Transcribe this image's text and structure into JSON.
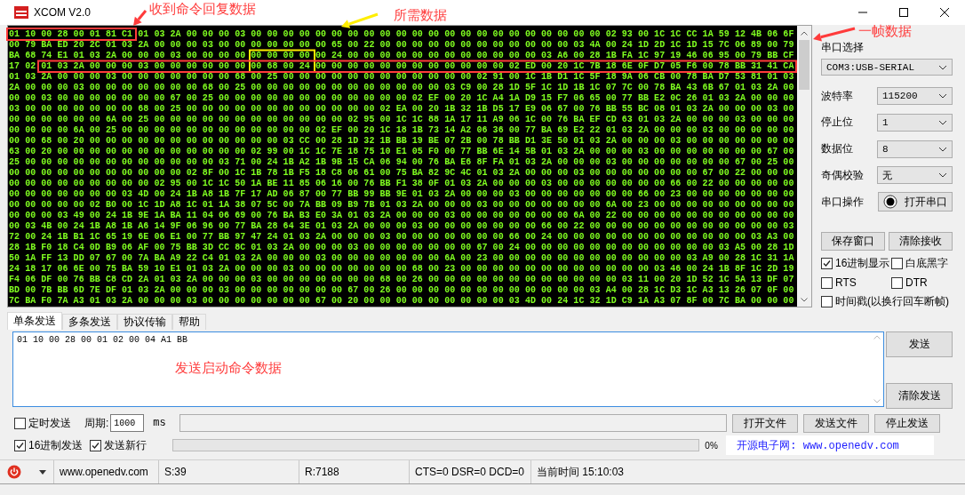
{
  "window": {
    "title": "XCOM V2.0"
  },
  "receive": {
    "rows": [
      "01 10 00 28 00 01 81 C1 01 03 2A 00 00 00 03 00 00 00 00 00 00 00 00 00 00 00 00 00 00 00 00 00 00 00 00 00 00 02 93 00 1C 1C CC 1A 59 12 4B 06 6F",
      "00 79 BA ED 20 2C 01 03 2A 00 00 00 03 00 00 00 00 00 00 00 65 00 22 00 00 00 00 00 00 00 00 00 00 00 00 03 4A 00 24 1D 2D 1C 1D 15 7C 06 89 00 79",
      "BA 68 74 E1 01 03 2A 00 00 00 03 00 00 00 00 00 00 00 00 00 24 00 00 00 00 00 00 00 00 00 00 00 00 03 A6 00 28 1B FA 1C 97 19 46 06 95 00 79 BB CF",
      "17 02 01 03 2A 00 00 00 03 00 00 00 00 00 00 00 68 00 24 00 00 00 00 00 00 00 00 00 00 00 00 02 ED 00 20 1C 7B 18 6E 0F D7 05 F6 00 78 BB 31 41 CA",
      "01 03 2A 00 00 00 03 00 00 00 00 00 00 00 68 00 25 00 00 00 00 00 00 00 00 00 00 00 00 02 91 00 1C 1B D1 1C 5F 18 9A 06 CB 00 78 BA D7 53 81 01 03",
      "2A 00 00 00 03 00 00 00 00 00 00 00 68 00 25 00 00 00 00 00 00 00 00 00 00 00 00 03 C9 00 28 1D 5F 1C 1D 1B 1C 07 7C 00 78 BA 43 6B 67 01 03 2A 00",
      "00 00 03 00 00 00 00 00 00 00 67 00 25 00 00 00 00 00 00 00 00 00 00 00 00 02 EF 00 20 1C A4 1A D9 15 F7 06 65 00 77 BB E2 0C 26 01 03 2A 00 00 00",
      "03 00 00 00 00 00 00 00 68 00 25 00 00 00 00 00 00 00 00 00 00 00 00 02 EA 00 20 1B 32 1B D5 17 E9 06 67 00 76 BB 55 BC 08 01 03 2A 00 00 00 03 00",
      "00 00 00 00 00 00 6A 00 25 00 00 00 00 00 00 00 00 00 00 00 00 02 95 00 1C 1C 88 1A 17 11 A9 06 1C 00 76 BA EF CD 63 01 03 2A 00 00 00 03 00 00 00",
      "00 00 00 00 6A 00 25 00 00 00 00 00 00 00 00 00 00 00 00 02 EF 00 20 1C 18 1B 73 14 A2 06 36 00 77 BA 69 E2 22 01 03 2A 00 00 00 03 00 00 00 00 00",
      "00 00 68 00 20 00 00 00 00 00 00 00 00 00 00 00 00 03 CC 00 28 1D 32 1B BB 19 BE 07 2B 00 78 BB D1 3E 50 01 03 2A 00 00 00 03 00 00 00 00 00 00 00",
      "63 00 20 00 00 00 00 00 00 00 00 00 00 00 00 02 99 00 1C 1C 7E 18 75 10 E1 05 F0 00 77 BB 6E 14 5B 01 03 2A 00 00 00 03 00 00 00 00 00 00 00 67 00",
      "25 00 00 00 00 00 00 00 00 00 00 00 00 03 71 00 24 1B A2 1B 9B 15 CA 06 94 00 76 BA E6 8F FA 01 03 2A 00 00 00 03 00 00 00 00 00 00 00 67 00 25 00",
      "00 00 00 00 00 00 00 00 00 00 00 02 8F 00 1C 1B 78 1B F5 18 C8 06 61 00 75 BA 82 9C 4C 01 03 2A 00 00 00 03 00 00 00 00 00 00 00 67 00 22 00 00 00",
      "00 00 00 00 00 00 00 00 00 02 95 00 1C 1C 50 1A BE 11 85 06 16 00 76 BB F1 38 0F 01 03 2A 00 00 00 03 00 00 00 00 00 00 00 66 00 22 00 00 00 00 00",
      "00 00 00 00 00 00 00 03 4D 00 24 1B A8 1B 7F 17 AD 06 87 00 77 BB 99 BB 9E 01 03 2A 00 00 00 03 00 00 00 00 00 00 00 66 00 23 00 00 00 00 00 00 00",
      "00 00 00 00 00 02 B0 00 1C 1D A8 1C 01 1A 38 07 5C 00 7A BB 09 B9 7B 01 03 2A 00 00 00 03 00 00 00 00 00 00 00 6A 00 23 00 00 00 00 00 00 00 00 00",
      "00 00 00 03 49 00 24 1B 9E 1A BA 11 04 06 69 00 76 BA B3 E0 3A 01 03 2A 00 00 00 03 00 00 00 00 00 00 00 6A 00 22 00 00 00 00 00 00 00 00 00 00 00",
      "00 03 4B 00 24 1B A8 1B A6 14 9F 06 96 00 77 BA 28 64 3E 01 03 2A 00 00 00 03 00 00 00 00 00 00 00 66 00 22 00 00 00 00 00 00 00 00 00 00 00 00 03",
      "72 00 24 1B B1 1C 65 19 6E 06 E1 00 77 BB 97 47 24 01 03 2A 00 00 00 03 00 00 00 00 00 00 00 66 00 24 00 00 00 00 00 00 00 00 00 00 00 00 03 A3 00",
      "28 1B F0 18 C4 0D B9 06 AF 00 75 BB 3D CC 8C 01 03 2A 00 00 00 03 00 00 00 00 00 00 00 67 00 24 00 00 00 00 00 00 00 00 00 00 00 00 03 A5 00 28 1D",
      "50 1A FF 13 DD 07 67 00 7A BA A9 22 C4 01 03 2A 00 00 00 03 00 00 00 00 00 00 00 6A 00 23 00 00 00 00 00 00 00 00 00 00 00 00 03 A9 00 28 1C 31 1A",
      "24 18 17 06 6E 00 75 BA 59 10 E1 01 03 2A 00 00 00 03 00 00 00 00 00 00 00 68 00 23 00 00 00 00 00 00 00 00 00 00 00 00 03 46 00 24 1B 8F 1C 2D 19",
      "F4 06 DF 00 76 BB C8 CD 2A 01 03 2A 00 00 00 03 00 00 00 00 00 00 00 68 00 26 00 00 00 00 00 00 00 00 00 00 00 00 03 11 00 20 1D 52 1C 5A 13 DF 07",
      "BD 00 7B BB 6D 7E DF 01 03 2A 00 00 00 03 00 00 00 00 00 00 00 67 00 26 00 00 00 00 00 00 00 00 00 00 00 00 03 A4 00 28 1C D3 1C A3 13 26 07 0F 00",
      "7C BA F0 7A A3 01 03 2A 00 00 00 03 00 00 00 00 00 00 00 67 00 20 00 00 00 00 00 00 00 00 00 03 4D 00 24 1C 32 1D C9 1A A3 07 8F 00 7C BA 00 00 00"
    ]
  },
  "annotations": [
    {
      "text": "收到命令回复数据",
      "color": "#ff3b3b"
    },
    {
      "text": "所需数据",
      "color": "#ff3b3b"
    },
    {
      "text": "一帧数据",
      "color": "#ff3b3b"
    },
    {
      "text": "发送启动命令数据",
      "color": "#ff3b3b"
    }
  ],
  "marks": [
    {
      "kind": "box",
      "color": "#ff3b3b"
    },
    {
      "kind": "arrow",
      "color": "#ff3b3b"
    },
    {
      "kind": "box",
      "color": "#ffee00"
    },
    {
      "kind": "arrow",
      "color": "#ffee00"
    },
    {
      "kind": "box",
      "color": "#ff3b3b"
    },
    {
      "kind": "arrow",
      "color": "#ff3b3b"
    }
  ],
  "port": {
    "label": "串口选择",
    "value": "COM3:USB-SERIAL"
  },
  "settings": [
    {
      "label": "波特率",
      "value": "115200"
    },
    {
      "label": "停止位",
      "value": "1"
    },
    {
      "label": "数据位",
      "value": "8"
    },
    {
      "label": "奇偶校验",
      "value": "无"
    }
  ],
  "operation": {
    "label": "串口操作",
    "button": "打开串口",
    "open": false
  },
  "receive_buttons": [
    "保存窗口",
    "清除接收"
  ],
  "options": [
    {
      "label": "16进制显示",
      "checked": true
    },
    {
      "label": "白底黑字",
      "checked": false
    },
    {
      "label": "RTS",
      "checked": false
    },
    {
      "label": "DTR",
      "checked": false
    },
    {
      "label": "时间戳(以换行回车断帧)",
      "checked": false
    }
  ],
  "tabs": [
    {
      "label": "单条发送",
      "selected": true
    },
    {
      "label": "多条发送",
      "selected": false
    },
    {
      "label": "协议传输",
      "selected": false
    },
    {
      "label": "帮助",
      "selected": false
    }
  ],
  "send": {
    "value": "01 10 00 28 00 01 02 00 04 A1 BB"
  },
  "send_buttons": [
    "发送",
    "清除发送"
  ],
  "timer": {
    "label": "定时发送",
    "checked": false
  },
  "period": {
    "label": "周期:",
    "value": "1000",
    "unit": "ms"
  },
  "file_buttons": [
    "打开文件",
    "发送文件",
    "停止发送"
  ],
  "hex_send": {
    "label": "16进制发送",
    "checked": true
  },
  "newline": {
    "label": "发送新行",
    "checked": true
  },
  "progress": {
    "level": 0,
    "reading": "0%"
  },
  "site_banner": "开源电子网: www.openedv.com",
  "status_bar": {
    "site": "www.openedv.com",
    "sent": "S:39",
    "received": "R:7188",
    "lines": "CTS=0 DSR=0 DCD=0",
    "time": "当前时间 15:10:03"
  }
}
